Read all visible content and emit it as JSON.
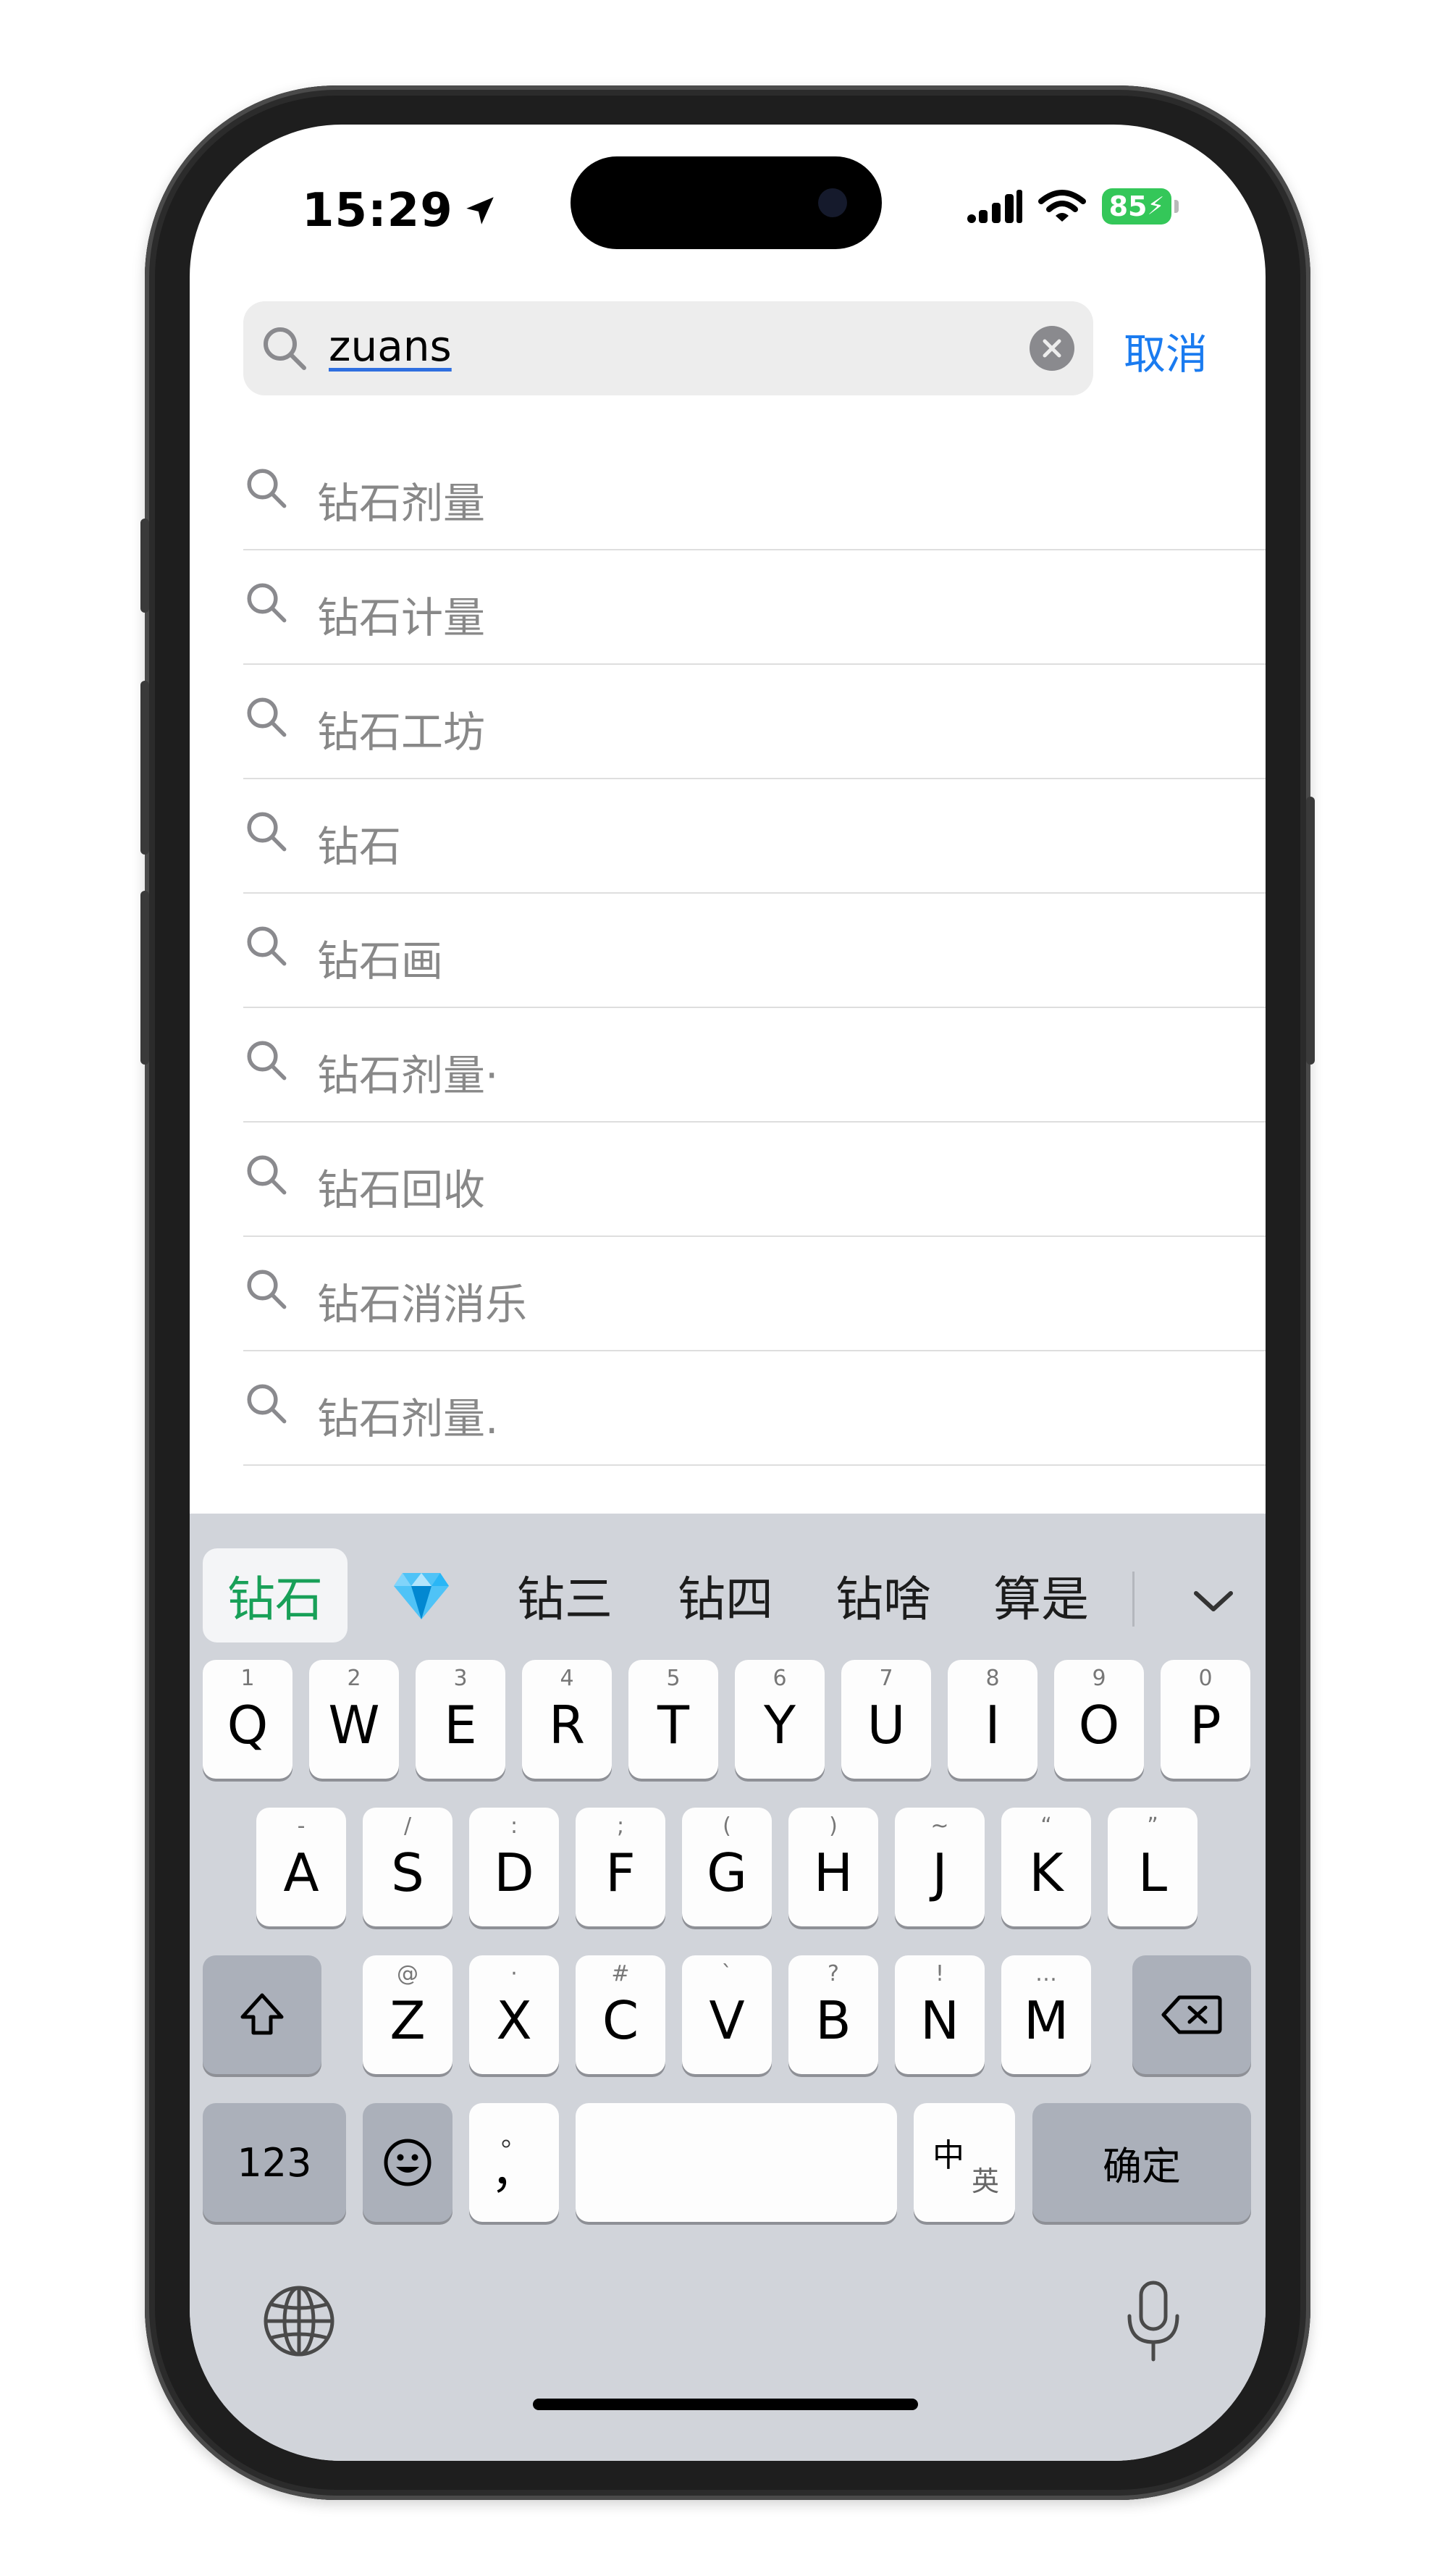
{
  "status_bar": {
    "time": "15:29",
    "battery": "85",
    "icons": [
      "location-arrow-icon",
      "cellular-signal-icon",
      "wifi-icon",
      "battery-charging-icon"
    ]
  },
  "search": {
    "value": "zuans",
    "cancel_label": "取消"
  },
  "suggestions": [
    "钻石剂量",
    "钻石计量",
    "钻石工坊",
    "钻石",
    "钻石画",
    "钻石剂量·",
    "钻石回收",
    "钻石消消乐",
    "钻石剂量."
  ],
  "candidates": {
    "selected": "钻石",
    "emoji": "💎",
    "items": [
      "钻三",
      "钻四",
      "钻啥",
      "算是"
    ]
  },
  "keyboard": {
    "row1": [
      {
        "key": "Q",
        "hint": "1"
      },
      {
        "key": "W",
        "hint": "2"
      },
      {
        "key": "E",
        "hint": "3"
      },
      {
        "key": "R",
        "hint": "4"
      },
      {
        "key": "T",
        "hint": "5"
      },
      {
        "key": "Y",
        "hint": "6"
      },
      {
        "key": "U",
        "hint": "7"
      },
      {
        "key": "I",
        "hint": "8"
      },
      {
        "key": "O",
        "hint": "9"
      },
      {
        "key": "P",
        "hint": "0"
      }
    ],
    "row2": [
      {
        "key": "A",
        "hint": "-"
      },
      {
        "key": "S",
        "hint": "/"
      },
      {
        "key": "D",
        "hint": ":"
      },
      {
        "key": "F",
        "hint": ";"
      },
      {
        "key": "G",
        "hint": "("
      },
      {
        "key": "H",
        "hint": ")"
      },
      {
        "key": "J",
        "hint": "~"
      },
      {
        "key": "K",
        "hint": "“"
      },
      {
        "key": "L",
        "hint": "”"
      }
    ],
    "row3": [
      {
        "key": "Z",
        "hint": "@"
      },
      {
        "key": "X",
        "hint": "·"
      },
      {
        "key": "C",
        "hint": "#"
      },
      {
        "key": "V",
        "hint": "`"
      },
      {
        "key": "B",
        "hint": "?"
      },
      {
        "key": "N",
        "hint": "!"
      },
      {
        "key": "M",
        "hint": "…"
      }
    ],
    "numbers_label": "123",
    "punct_label": "，",
    "punct_hint": "。",
    "lang_label_top": "中",
    "lang_label_bottom": "英",
    "confirm_label": "确定"
  }
}
